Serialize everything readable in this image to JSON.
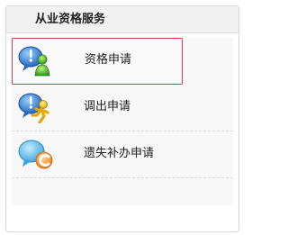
{
  "panel": {
    "title": "从业资格服务"
  },
  "items": [
    {
      "label": "资格申请",
      "icon": "user-add-icon",
      "selected": true
    },
    {
      "label": "调出申请",
      "icon": "user-run-icon",
      "selected": false
    },
    {
      "label": "遗失补办申请",
      "icon": "chat-reissue-icon",
      "selected": false
    }
  ],
  "colors": {
    "selection_border": "#d1414b",
    "header_bg": "#f1f1f1",
    "list_bg": "#f8f8f8"
  }
}
